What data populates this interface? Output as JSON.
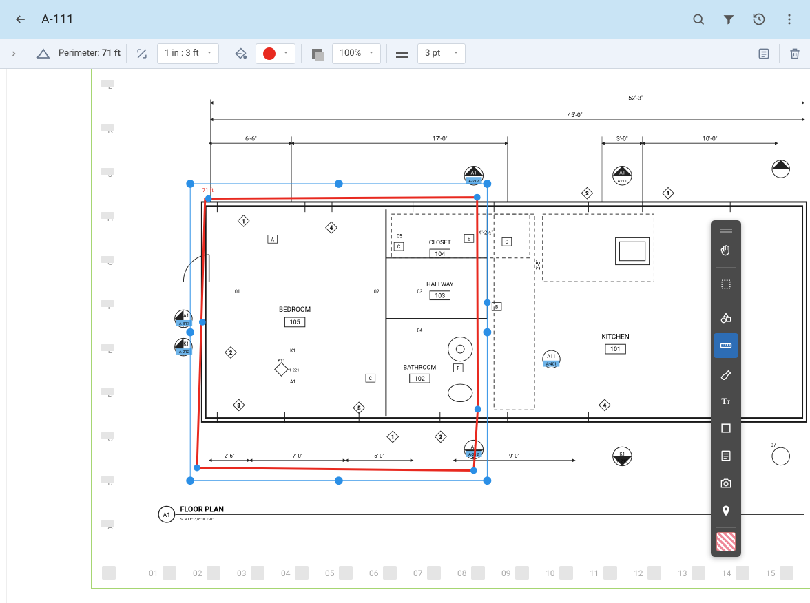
{
  "header": {
    "title": "A-111"
  },
  "toolbar": {
    "perimeter_label": "Perimeter: ",
    "perimeter_value": "71 ft",
    "scale": "1 in : 3 ft",
    "opacity": "100%",
    "lineweight": "3 pt"
  },
  "rulers": {
    "vertical": [
      "L",
      "K",
      "J",
      "H",
      "G",
      "F",
      "E",
      "D",
      "C",
      "B",
      "A"
    ],
    "horizontal": [
      "01",
      "02",
      "03",
      "04",
      "05",
      "06",
      "07",
      "08",
      "09",
      "10",
      "11",
      "12",
      "13",
      "14",
      "15"
    ]
  },
  "floorplan": {
    "title": "FLOOR PLAN",
    "tag": "A1",
    "scale_note": "SCALE: 3/8\" = 1'-0\"",
    "dims": {
      "overall": "52'-3\"",
      "inner": "45'-0\"",
      "d1": "6'-6\"",
      "d2": "17'-0\"",
      "d3": "3'-0\"",
      "d4": "10'-0\"",
      "b1": "2'-6\"",
      "b2": "7'-0\"",
      "b3": "5'-0\"",
      "b4": "9'-0\"",
      "v1": "2'-5\"",
      "v2": "4'-2½\""
    },
    "rooms": {
      "bedroom": {
        "name": "BEDROOM",
        "num": "105"
      },
      "closet": {
        "name": "CLOSET",
        "num": "104"
      },
      "hallway": {
        "name": "HALLWAY",
        "num": "103"
      },
      "bathroom": {
        "name": "BATHROOM",
        "num": "102"
      },
      "kitchen": {
        "name": "KITCHEN",
        "num": "101"
      }
    },
    "callouts": {
      "a1_212": "A-212",
      "a1_211": "A211",
      "a1_317": "A-317",
      "k1_212": "A-212",
      "a11_401": "A-401",
      "k1_213": "A-213",
      "k1_221": "1-221",
      "a12": "A12",
      "a1": "A1",
      "k1": "K1",
      "a11": "A11"
    },
    "annot_perimeter": "71 ft",
    "room_tags": [
      "A",
      "C",
      "E",
      "G",
      "B",
      "F",
      "C",
      "01",
      "02",
      "03",
      "04",
      "05"
    ]
  },
  "markers": {
    "one": "1",
    "two": "2",
    "three": "3",
    "four": "4",
    "five": "5"
  }
}
